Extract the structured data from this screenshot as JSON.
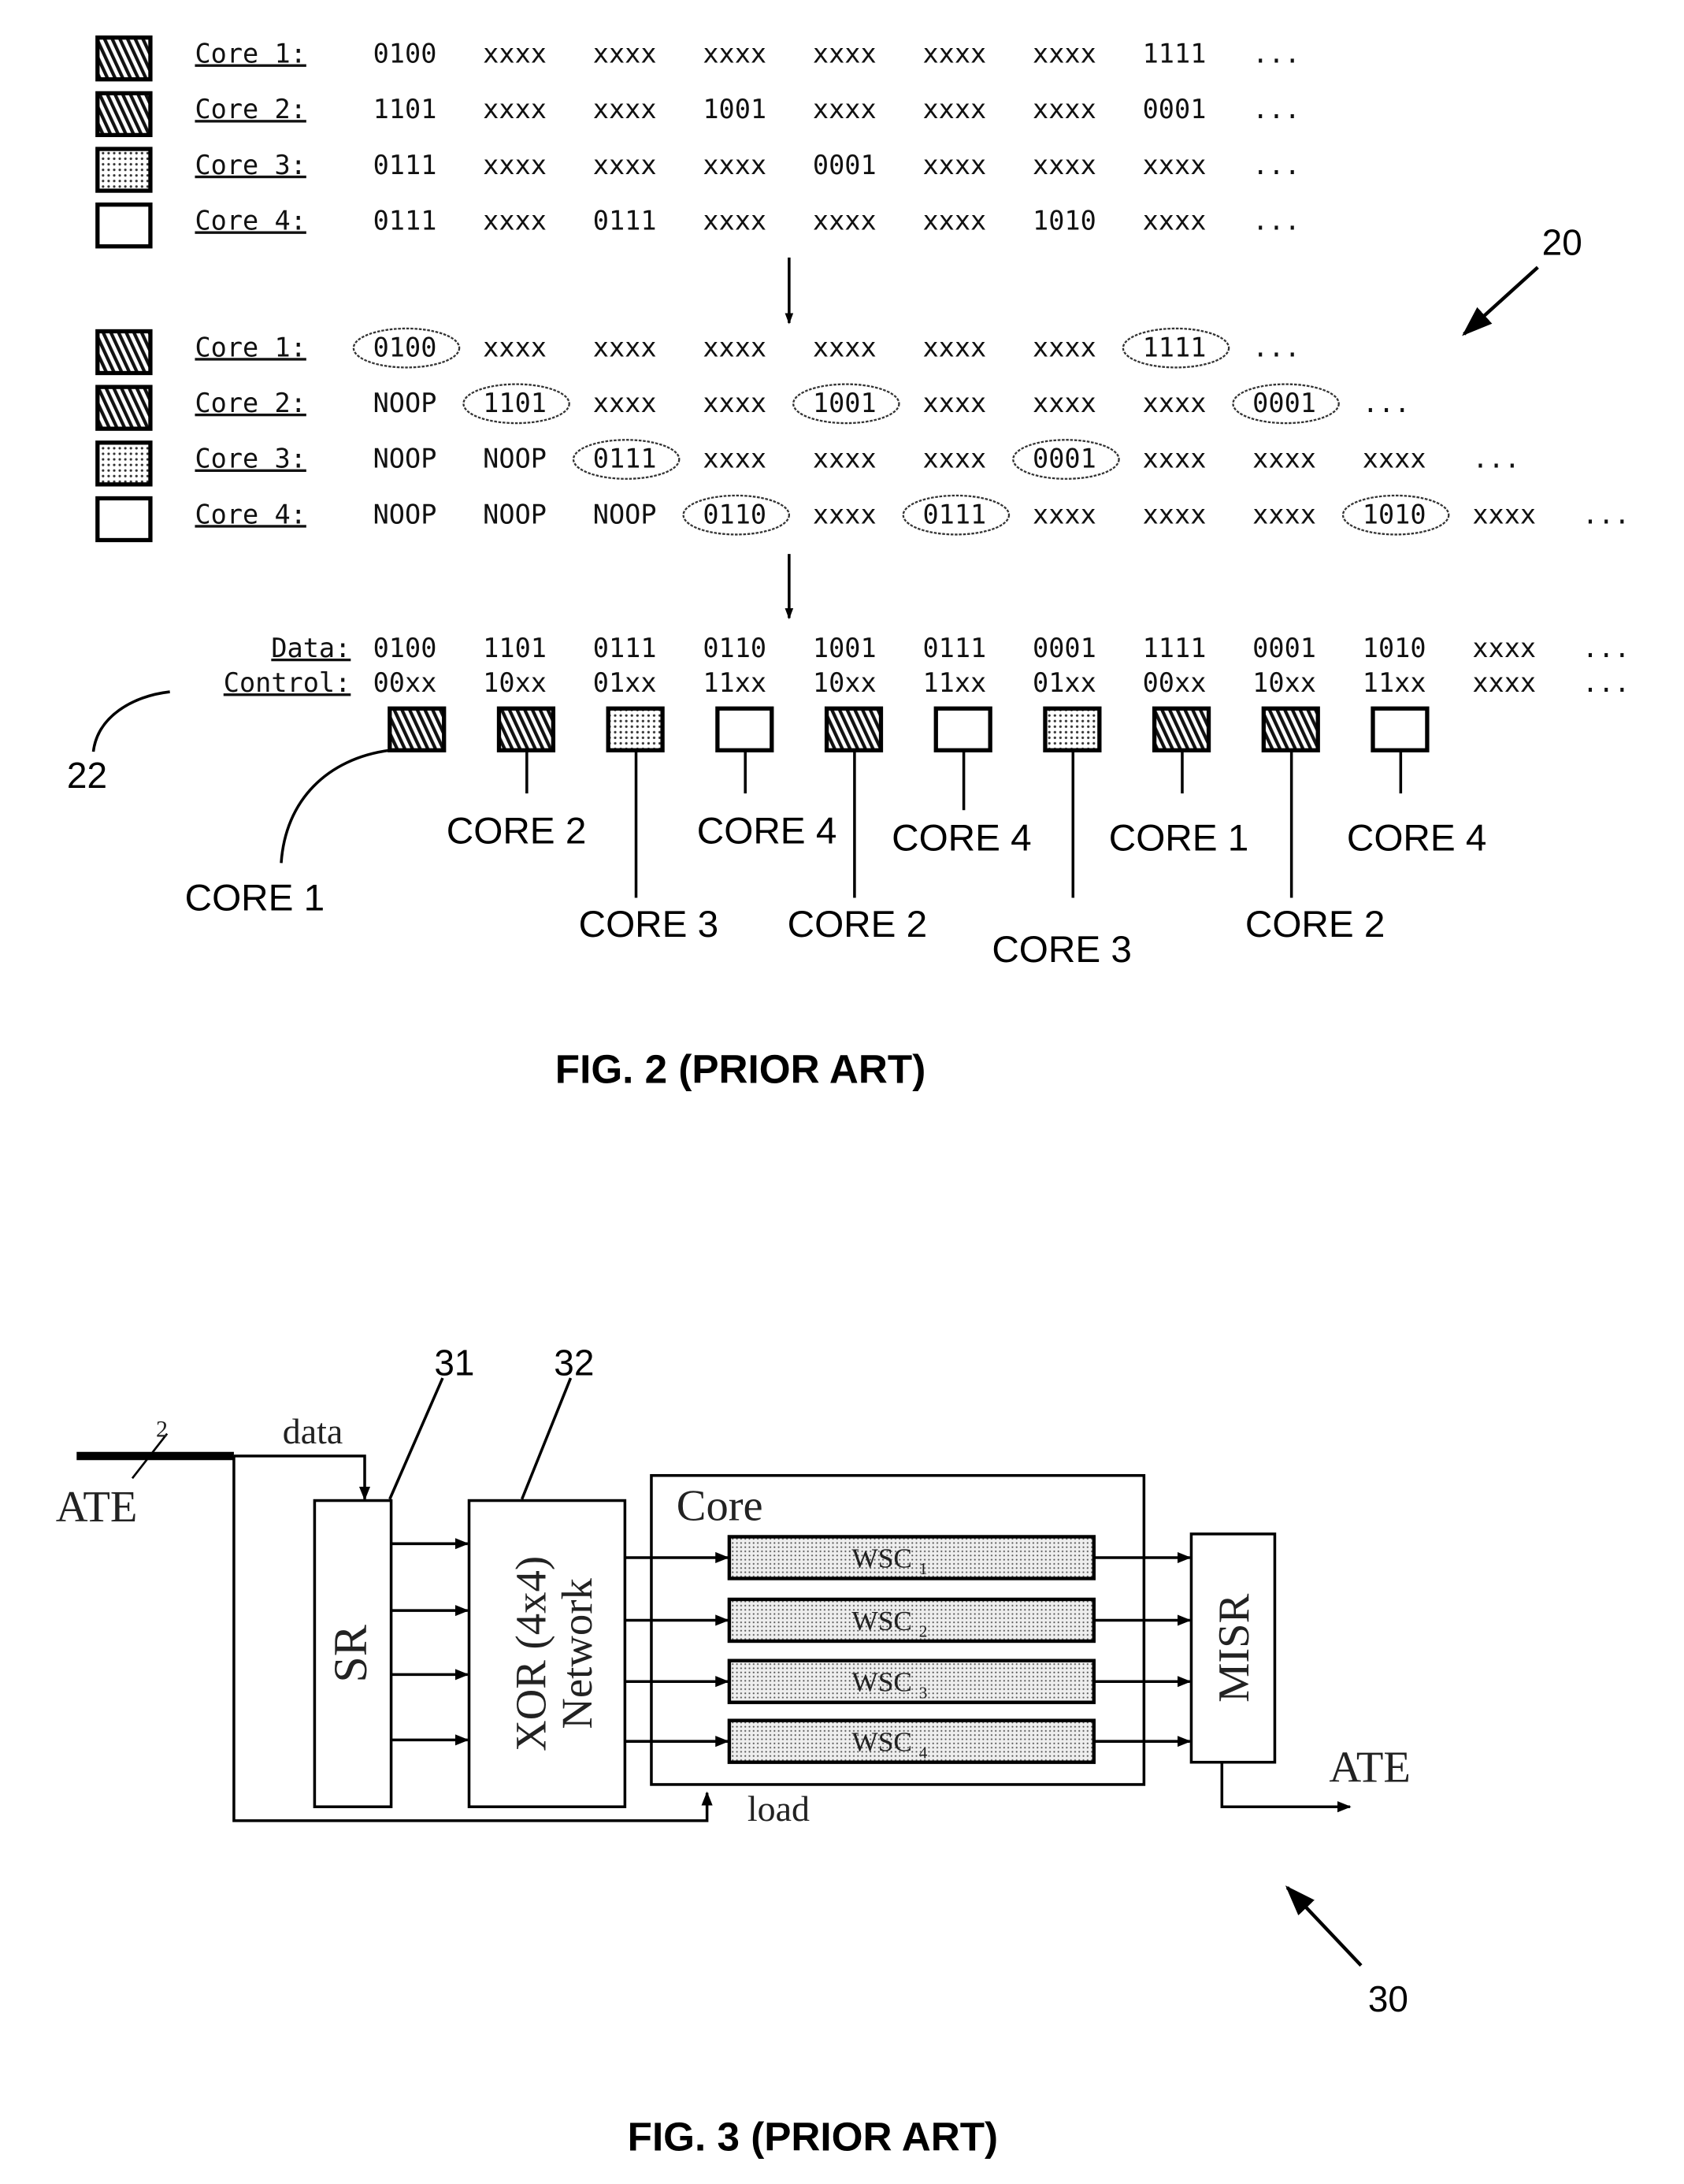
{
  "fig2": {
    "caption": "FIG. 2 (PRIOR ART)",
    "ref_20": "20",
    "ref_22": "22",
    "original_streams": [
      {
        "label": "Core 1:",
        "pattern": "diag",
        "words": [
          "0100",
          "xxxx",
          "xxxx",
          "xxxx",
          "xxxx",
          "xxxx",
          "xxxx",
          "1111",
          "..."
        ]
      },
      {
        "label": "Core 2:",
        "pattern": "diag",
        "words": [
          "1101",
          "xxxx",
          "xxxx",
          "1001",
          "xxxx",
          "xxxx",
          "xxxx",
          "0001",
          "..."
        ]
      },
      {
        "label": "Core 3:",
        "pattern": "dots",
        "words": [
          "0111",
          "xxxx",
          "xxxx",
          "xxxx",
          "0001",
          "xxxx",
          "xxxx",
          "xxxx",
          "..."
        ]
      },
      {
        "label": "Core 4:",
        "pattern": "white",
        "words": [
          "0111",
          "xxxx",
          "0111",
          "xxxx",
          "xxxx",
          "xxxx",
          "1010",
          "xxxx",
          "..."
        ]
      }
    ],
    "shifted_streams": [
      {
        "label": "Core 1:",
        "pattern": "diag",
        "words": [
          "0100",
          "xxxx",
          "xxxx",
          "xxxx",
          "xxxx",
          "xxxx",
          "xxxx",
          "1111",
          "..."
        ],
        "circled": [
          0,
          7
        ]
      },
      {
        "label": "Core 2:",
        "pattern": "diag",
        "words": [
          "NOOP",
          "1101",
          "xxxx",
          "xxxx",
          "1001",
          "xxxx",
          "xxxx",
          "xxxx",
          "0001",
          "..."
        ],
        "circled": [
          1,
          4,
          8
        ]
      },
      {
        "label": "Core 3:",
        "pattern": "dots",
        "words": [
          "NOOP",
          "NOOP",
          "0111",
          "xxxx",
          "xxxx",
          "xxxx",
          "0001",
          "xxxx",
          "xxxx",
          "xxxx",
          "..."
        ],
        "circled": [
          2,
          6
        ]
      },
      {
        "label": "Core 4:",
        "pattern": "white",
        "words": [
          "NOOP",
          "NOOP",
          "NOOP",
          "0110",
          "xxxx",
          "0111",
          "xxxx",
          "xxxx",
          "xxxx",
          "1010",
          "xxxx",
          "..."
        ],
        "circled": [
          3,
          5,
          9
        ]
      }
    ],
    "data_label": "Data:",
    "data_words": [
      "0100",
      "1101",
      "0111",
      "0110",
      "1001",
      "0111",
      "0001",
      "1111",
      "0001",
      "1010",
      "xxxx",
      "..."
    ],
    "control_label": "Control:",
    "control_words": [
      "00xx",
      "10xx",
      "01xx",
      "11xx",
      "10xx",
      "11xx",
      "01xx",
      "00xx",
      "10xx",
      "11xx",
      "xxxx",
      "..."
    ],
    "slots": [
      {
        "pattern": "diag",
        "core": "CORE 1"
      },
      {
        "pattern": "diag",
        "core": "CORE 2"
      },
      {
        "pattern": "dots",
        "core": "CORE 3"
      },
      {
        "pattern": "white",
        "core": "CORE 4"
      },
      {
        "pattern": "diag",
        "core": "CORE 2"
      },
      {
        "pattern": "white",
        "core": "CORE 4"
      },
      {
        "pattern": "dots",
        "core": "CORE 3"
      },
      {
        "pattern": "diag",
        "core": "CORE 1"
      },
      {
        "pattern": "diag",
        "core": "CORE 2"
      },
      {
        "pattern": "white",
        "core": "CORE 4"
      }
    ]
  },
  "fig3": {
    "caption": "FIG. 3 (PRIOR ART)",
    "ref_30": "30",
    "ref_31": "31",
    "ref_32": "32",
    "ate_in": "ATE",
    "ate_out": "ATE",
    "bus_width": "2",
    "data_label": "data",
    "load_label": "load",
    "sr_label": "SR",
    "xor_line1": "XOR (4x4)",
    "xor_line2": "Network",
    "core_label": "Core",
    "wsc": [
      {
        "name": "WSC",
        "sub": "1"
      },
      {
        "name": "WSC",
        "sub": "2"
      },
      {
        "name": "WSC",
        "sub": "3"
      },
      {
        "name": "WSC",
        "sub": "4"
      }
    ],
    "misr_label": "MISR"
  }
}
